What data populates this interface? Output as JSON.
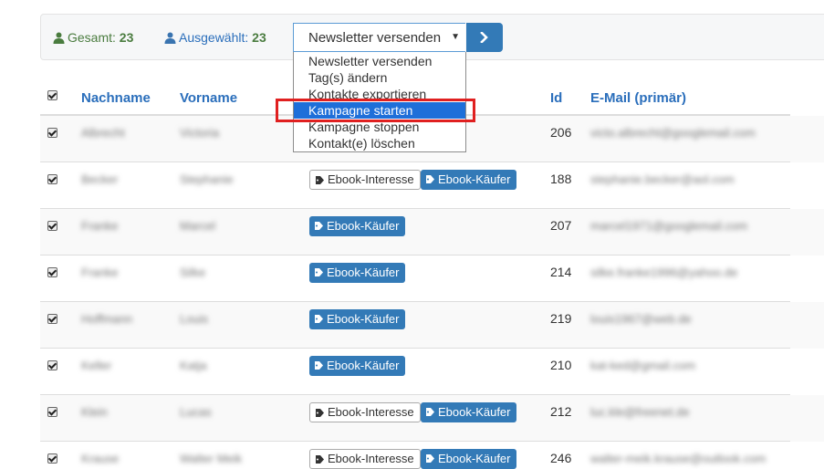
{
  "toolbar": {
    "total_label": "Gesamt:",
    "total_count": "23",
    "selected_label": "Ausgewählt:",
    "selected_count": "23",
    "action_select_value": "Newsletter versenden",
    "go_icon": "chevron-right-icon"
  },
  "dropdown": {
    "options": [
      "Newsletter versenden",
      "Tag(s) ändern",
      "Kontakte exportieren",
      "Kampagne starten",
      "Kampagne stoppen",
      "Kontakt(e) löschen"
    ],
    "highlighted": "Kampagne starten"
  },
  "table": {
    "headers": {
      "lastname": "Nachname",
      "firstname": "Vorname",
      "id": "Id",
      "email": "E-Mail (primär)"
    },
    "rows": [
      {
        "lastname": "Albrecht",
        "firstname": "Victoria",
        "tags": [],
        "id": "206",
        "email": "victo.albrecht@googlemail.com"
      },
      {
        "lastname": "Becker",
        "firstname": "Stephanie",
        "tags": [
          {
            "label": "Ebook-Interesse",
            "style": "light"
          },
          {
            "label": "Ebook-Käufer",
            "style": "blue"
          }
        ],
        "id": "188",
        "email": "stephanie.becker@aol.com"
      },
      {
        "lastname": "Franke",
        "firstname": "Marcel",
        "tags": [
          {
            "label": "Ebook-Käufer",
            "style": "blue"
          }
        ],
        "id": "207",
        "email": "marcel1971@googlemail.com"
      },
      {
        "lastname": "Franke",
        "firstname": "Silke",
        "tags": [
          {
            "label": "Ebook-Käufer",
            "style": "blue"
          }
        ],
        "id": "214",
        "email": "silke.franke1996@yahoo.de"
      },
      {
        "lastname": "Hoffmann",
        "firstname": "Louis",
        "tags": [
          {
            "label": "Ebook-Käufer",
            "style": "blue"
          }
        ],
        "id": "219",
        "email": "louis1967@web.de"
      },
      {
        "lastname": "Keller",
        "firstname": "Katja",
        "tags": [
          {
            "label": "Ebook-Käufer",
            "style": "blue"
          }
        ],
        "id": "210",
        "email": "kat-ked@gmail.com"
      },
      {
        "lastname": "Klein",
        "firstname": "Lucas",
        "tags": [
          {
            "label": "Ebook-Interesse",
            "style": "light"
          },
          {
            "label": "Ebook-Käufer",
            "style": "blue"
          }
        ],
        "id": "212",
        "email": "luc.kle@freenet.de"
      },
      {
        "lastname": "Krause",
        "firstname": "Walter Meik",
        "tags": [
          {
            "label": "Ebook-Interesse",
            "style": "light"
          },
          {
            "label": "Ebook-Käufer",
            "style": "blue"
          }
        ],
        "id": "246",
        "email": "walter-meik.krause@outlook.com"
      }
    ]
  },
  "colors": {
    "accent": "#337ab7",
    "header_text": "#2a6ebb",
    "stat_green": "#4a7c3f",
    "highlight_red": "#e02020",
    "dropdown_active": "#1e6fd9"
  }
}
